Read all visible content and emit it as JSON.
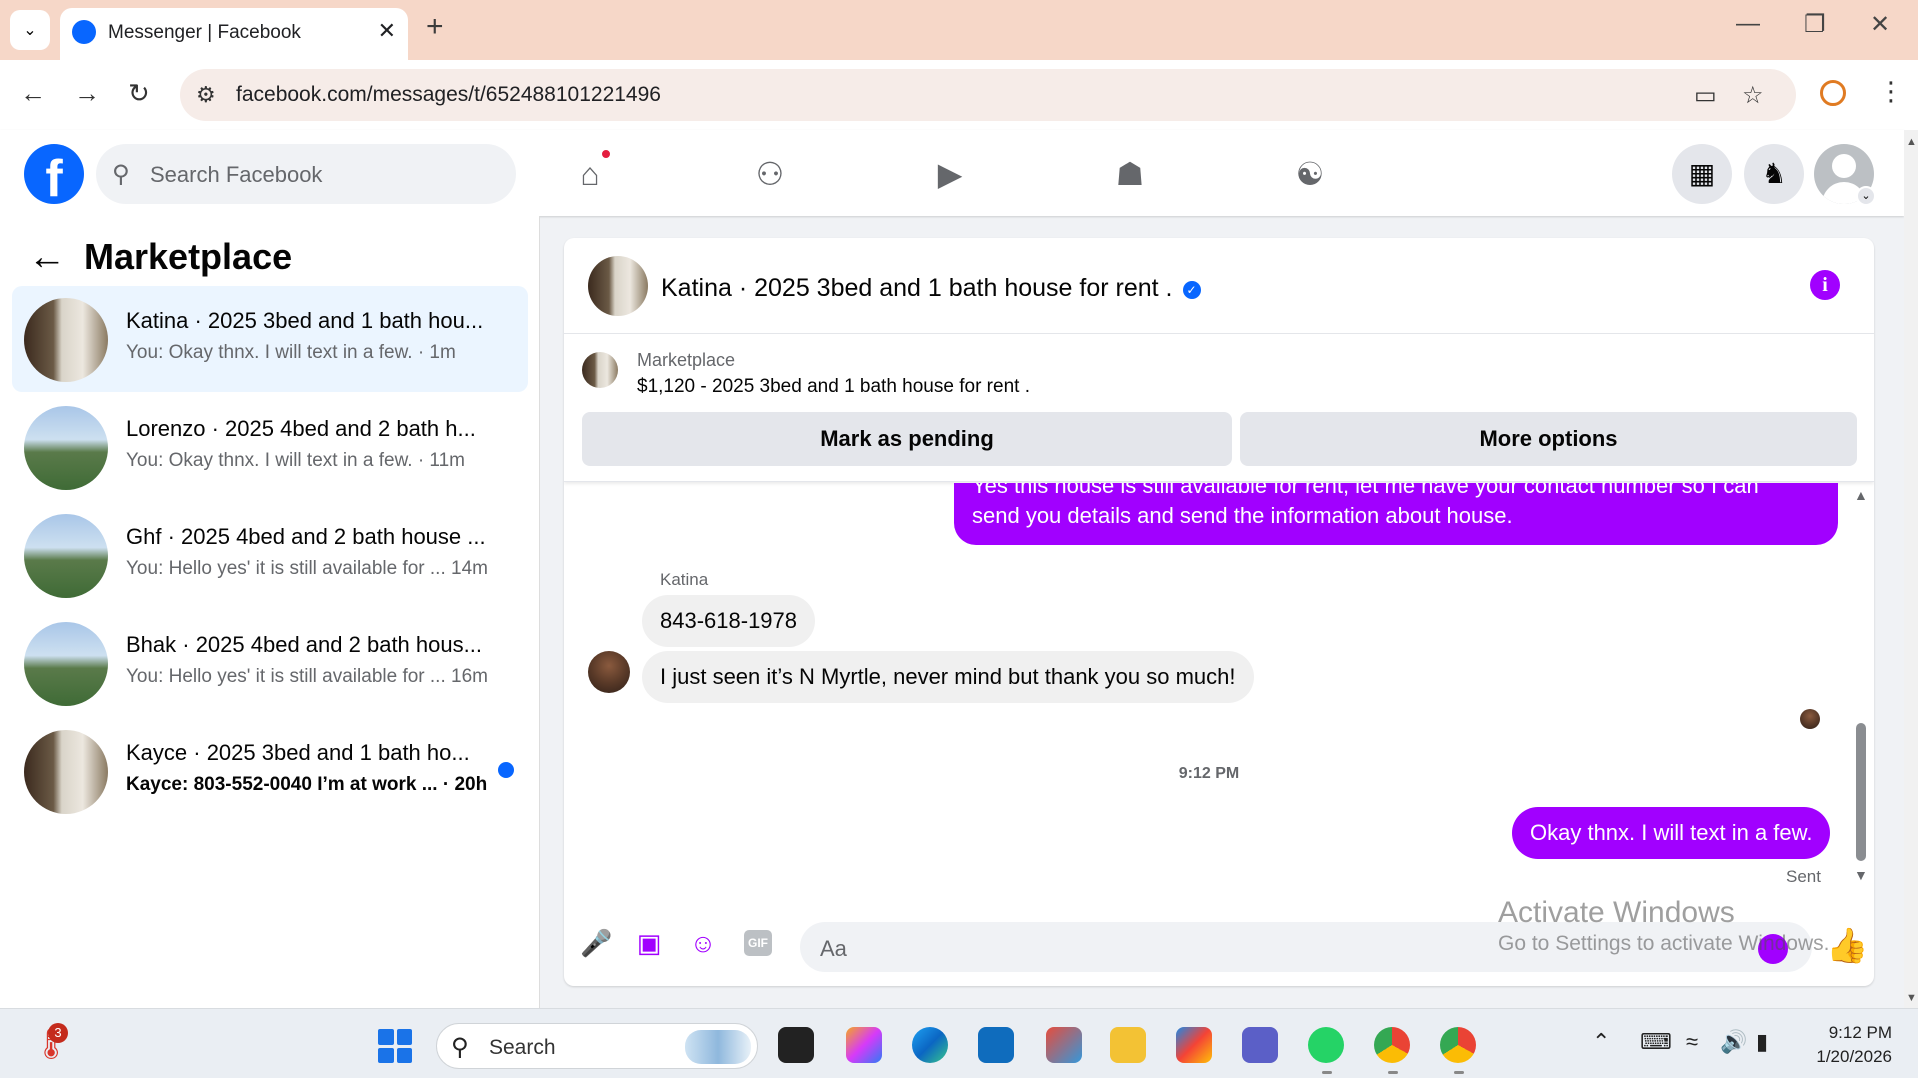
{
  "browser": {
    "tab_title": "Messenger | Facebook",
    "url": "facebook.com/messages/t/652488101221496",
    "new_tab_symbol": "+",
    "tab_close_symbol": "✕"
  },
  "header": {
    "search_placeholder": "Search Facebook",
    "logo_letter": "f"
  },
  "sidebar": {
    "title": "Marketplace",
    "conversations": [
      {
        "name": "Katina · 2025 3bed and 1 bath hou...",
        "preview": "You: Okay thnx. I will text in a few. · 1m",
        "active": true,
        "unread": false,
        "avatar": "door-photo"
      },
      {
        "name": "Lorenzo · 2025 4bed and 2 bath h...",
        "preview": "You: Okay thnx. I will text in a few. · 11m",
        "active": false,
        "unread": false,
        "avatar": "house-photo"
      },
      {
        "name": "Ghf · 2025 4bed and 2 bath house ...",
        "preview": "You: Hello yes' it is still available for ...  14m",
        "active": false,
        "unread": false,
        "avatar": "house-photo"
      },
      {
        "name": "Bhak · 2025 4bed and 2 bath hous...",
        "preview": "You: Hello yes' it is still available for ...  16m",
        "active": false,
        "unread": false,
        "avatar": "house-photo"
      },
      {
        "name": "Kayce · 2025 3bed and 1 bath ho...",
        "preview": "Kayce: 803-552-0040 I’m at work ... · 20h",
        "active": false,
        "unread": true,
        "avatar": "door-photo"
      }
    ]
  },
  "chat": {
    "title": "Katina · 2025 3bed and 1 bath house for rent .",
    "verified_symbol": "✓",
    "info_symbol": "i",
    "listing_label": "Marketplace",
    "listing_desc": "$1,120 - 2025 3bed and 1 bath house for rent .",
    "mark_pending_label": "Mark as pending",
    "more_options_label": "More options",
    "outgoing_partial_line1": "Yes this house is still available for rent, let me have your contact number so I can",
    "outgoing_partial_line2": "send you details and send the information about house.",
    "sender_name": "Katina",
    "incoming_1": "843-618-1978",
    "incoming_2": "I just seen it’s N Myrtle, never mind but thank you so much!",
    "timestamp": "9:12 PM",
    "outgoing_last": "Okay thnx. I will text in a few.",
    "sent_label": "Sent",
    "composer_placeholder": "Aa",
    "gif_label": "GIF"
  },
  "watermark": {
    "line1": "Activate Windows",
    "line2": "Go to Settings to activate Windows."
  },
  "taskbar": {
    "search_label": "Search",
    "weather_badge": "3",
    "time": "9:12 PM",
    "date": "1/20/2026"
  },
  "colors": {
    "accent": "#a100ff",
    "fb_blue": "#0866ff",
    "active_conv_bg": "#ebf5ff"
  }
}
